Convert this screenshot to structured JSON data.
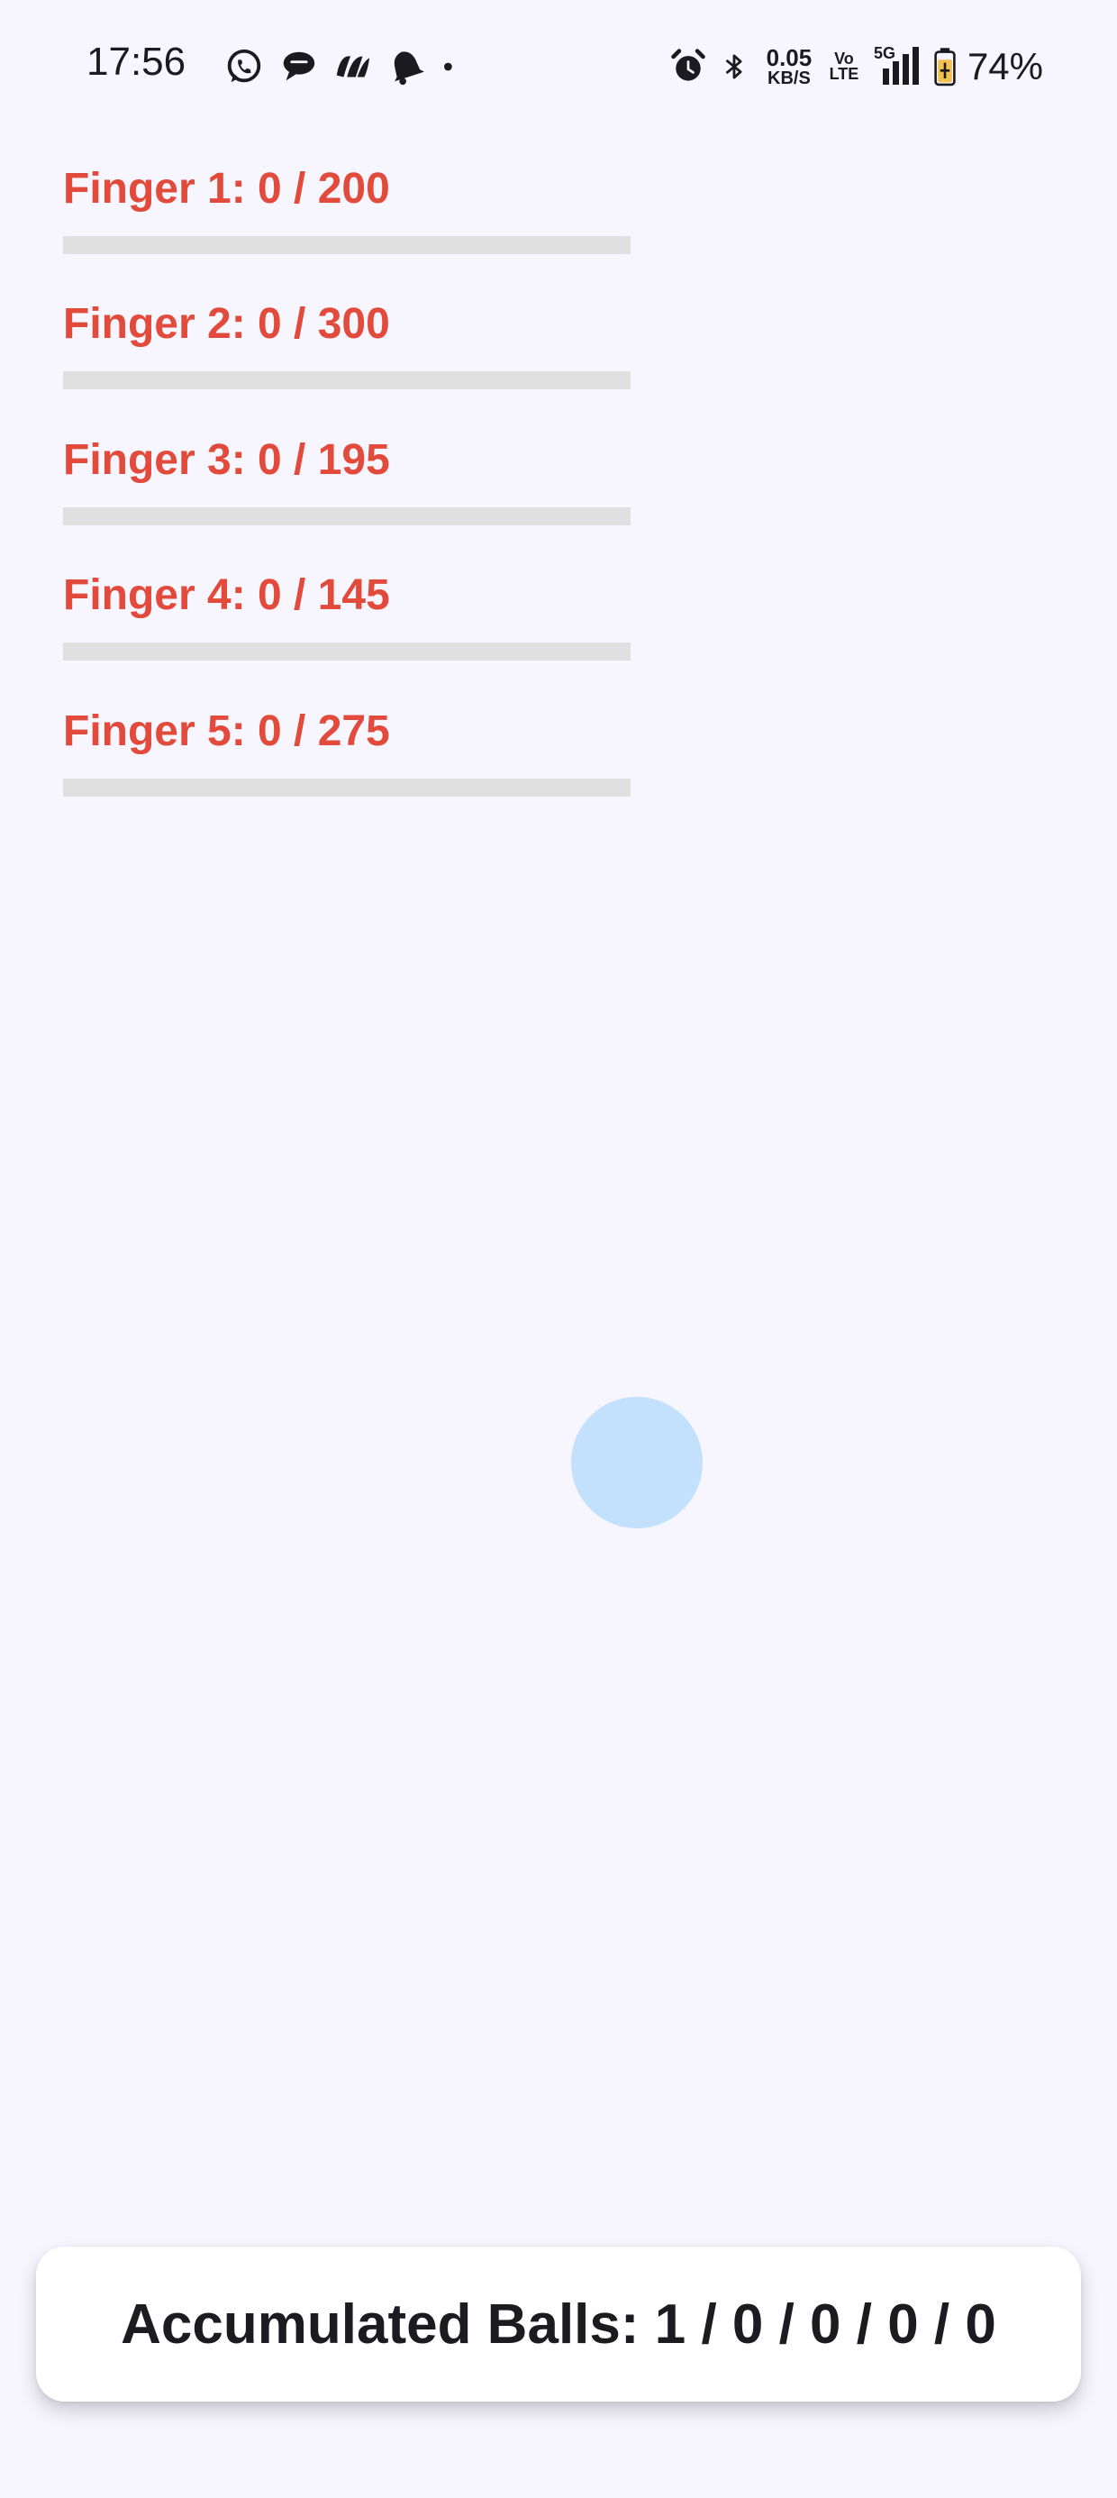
{
  "status_bar": {
    "time": "17:56",
    "notification_icons": [
      "whatsapp-icon",
      "chat-bubble-icon",
      "app-logo-icon",
      "bell-icon",
      "dot-icon"
    ],
    "alarm_icon": "alarm-icon",
    "bluetooth_icon": "bluetooth-icon",
    "net_speed_value": "0.05",
    "net_speed_unit": "KB/S",
    "volte_top": "Vo",
    "volte_bottom": "LTE",
    "network_label": "5G",
    "battery_icon": "battery-charging-icon",
    "battery_percent": "74%"
  },
  "fingers": [
    {
      "label": "Finger 1: 0 / 200",
      "current": 0,
      "target": 200,
      "progress": 0
    },
    {
      "label": "Finger 2: 0 / 300",
      "current": 0,
      "target": 300,
      "progress": 0
    },
    {
      "label": "Finger 3: 0 / 195",
      "current": 0,
      "target": 195,
      "progress": 0
    },
    {
      "label": "Finger 4: 0 / 145",
      "current": 0,
      "target": 145,
      "progress": 0
    },
    {
      "label": "Finger 5: 0 / 275",
      "current": 0,
      "target": 275,
      "progress": 0
    }
  ],
  "accumulated": {
    "label": "Accumulated Balls: 1 / 0 / 0 / 0 / 0"
  },
  "colors": {
    "background": "#f7f5fe",
    "finger_label": "#e24a3b",
    "progress_track": "#e0e0e0",
    "ball": "#c3e0fc",
    "card": "#ffffff"
  }
}
